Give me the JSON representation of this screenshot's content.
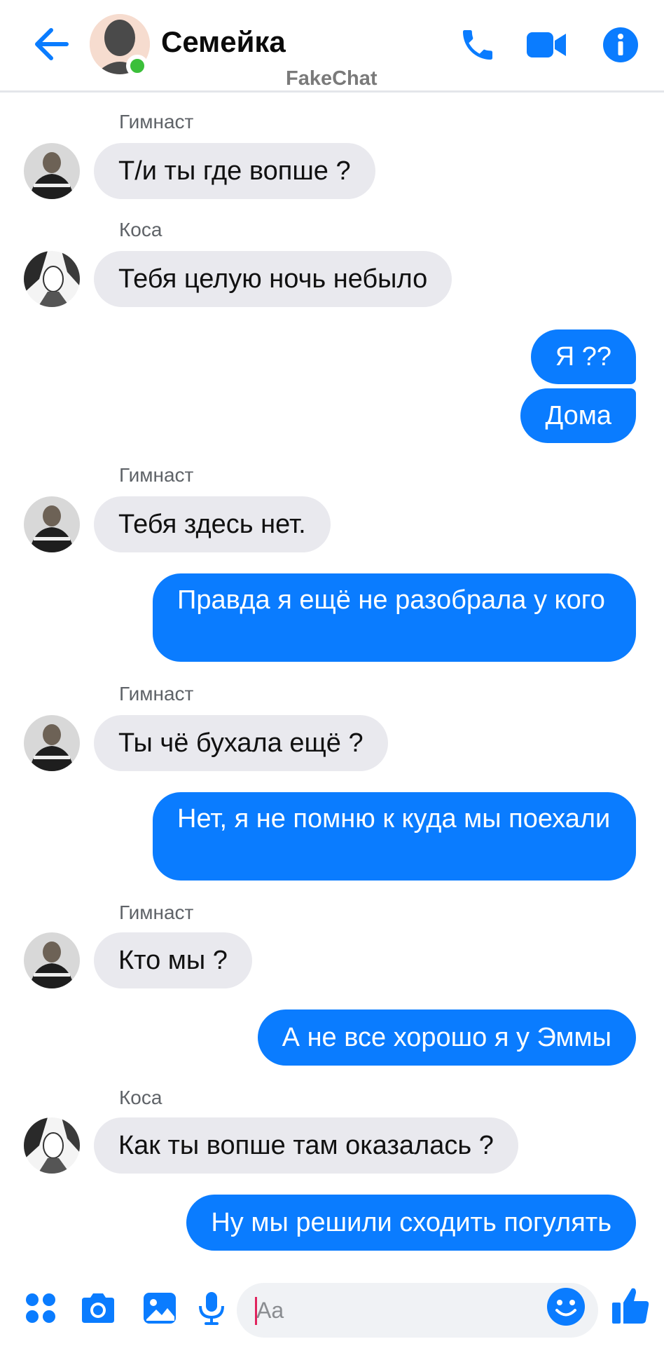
{
  "header": {
    "title": "Семейка",
    "watermark": "FakeChat"
  },
  "messages": [
    {
      "sender": "Гимнаст",
      "text": "Т/и ты где вопше ?"
    },
    {
      "sender": "Коса",
      "text": "Тебя целую ночь небыло"
    },
    {
      "text": "Я ??"
    },
    {
      "text": "Дома"
    },
    {
      "sender": "Гимнаст",
      "text": "Тебя здесь нет."
    },
    {
      "text": "Правда я ещё не разобрала у кого"
    },
    {
      "sender": "Гимнаст",
      "text": "Ты чё бухала ещё ?"
    },
    {
      "text": "Нет, я не помню к куда мы поехали"
    },
    {
      "sender": "Гимнаст",
      "text": "Кто мы ?"
    },
    {
      "text": "А не все хорошо я у Эммы"
    },
    {
      "sender": "Коса",
      "text": "Как ты вопше там оказалась ?"
    },
    {
      "text": "Ну мы решили сходить погулять"
    }
  ],
  "composer": {
    "placeholder": "Aa"
  },
  "colors": {
    "accent": "#0a7cff",
    "incoming_bubble": "#e9e9ee",
    "online": "#3bbf3a"
  },
  "icons": {
    "back": "arrow-left-icon",
    "call": "phone-icon",
    "video": "video-camera-icon",
    "info": "info-icon",
    "apps": "grid-dots-icon",
    "camera": "camera-icon",
    "gallery": "image-icon",
    "mic": "microphone-icon",
    "emoji": "smiley-icon",
    "like": "thumbs-up-icon"
  }
}
